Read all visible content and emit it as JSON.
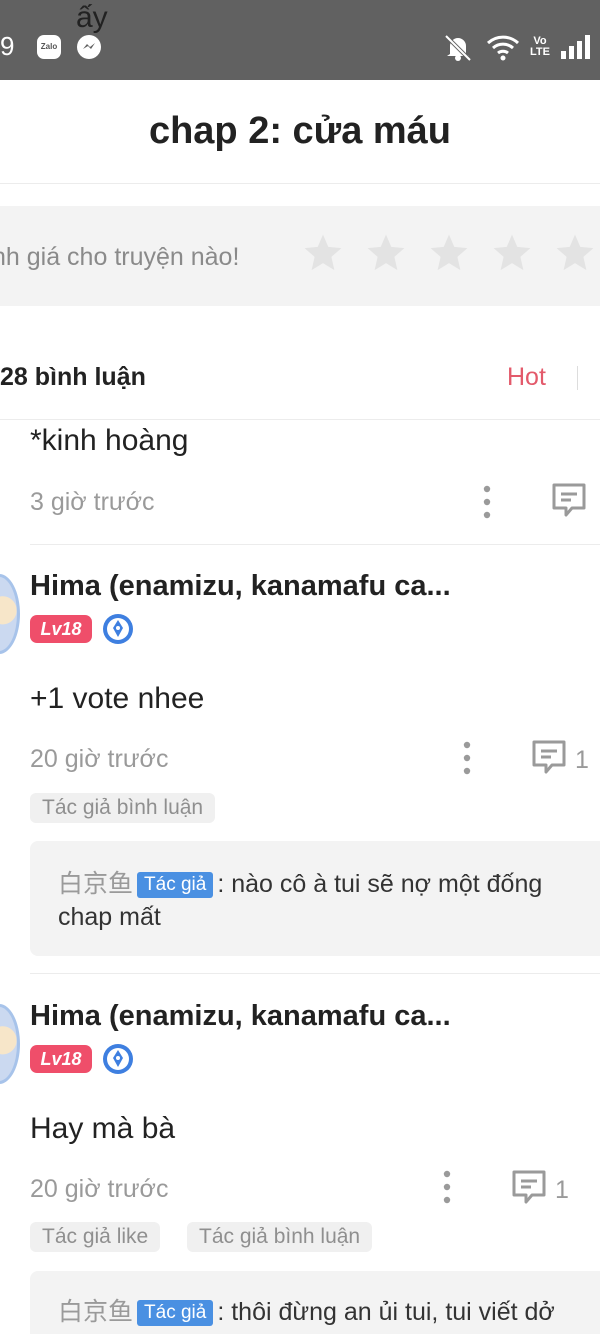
{
  "status_bar": {
    "time_partial": "9",
    "notification_text": "ấy",
    "apps": [
      "zalo-icon",
      "messenger-icon"
    ],
    "zalo_label": "Zalo",
    "volte_label": "Vo LTE",
    "status_icons": [
      "mute-icon",
      "wifi-icon",
      "volte-icon",
      "signal-icon"
    ]
  },
  "header": {
    "title": "chap 2: cửa máu"
  },
  "rating": {
    "prompt": "nh giá cho truyện nào!",
    "stars": 5
  },
  "comments_header": {
    "count_label": "28 bình luận",
    "sort_label": "Hot"
  },
  "comments": [
    {
      "text": "*kinh hoàng",
      "time": "3 giờ trước"
    },
    {
      "username": "Hima (enamizu, kanamafu ca...",
      "level": "Lv18",
      "text": "+1 vote nhee",
      "time": "20 giờ trước",
      "reply_count": "1",
      "tags": [
        "Tác giả bình luận"
      ],
      "reply": {
        "author": "白京鱼",
        "badge": "Tác giả",
        "line1": ": nào cô à tui sẽ nợ một đống",
        "line2": "chap mất"
      }
    },
    {
      "username": "Hima (enamizu, kanamafu ca...",
      "level": "Lv18",
      "text": "Hay mà bà",
      "time": "20 giờ trước",
      "reply_count": "1",
      "tags": [
        "Tác giả like",
        "Tác giả bình luận"
      ],
      "reply": {
        "author": "白京鱼",
        "badge": "Tác giả",
        "line1": ": thôi đừng an ủi tui, tui viết dở"
      }
    }
  ],
  "colors": {
    "accent": "#e35a6b",
    "level_badge": "#ef4e6a",
    "author_badge": "#4a90e2",
    "star": "#e3e3e3"
  }
}
